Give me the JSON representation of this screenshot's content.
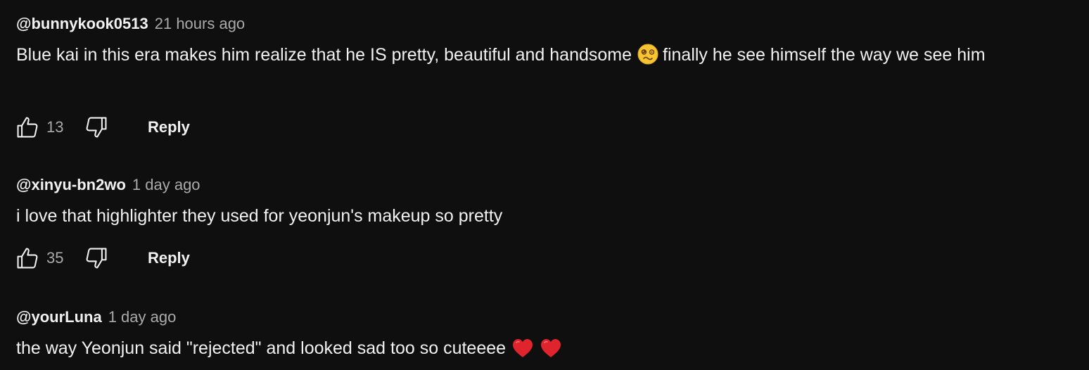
{
  "comments": [
    {
      "author": "@bunnykook0513",
      "time": "21 hours ago",
      "text_before": "Blue kai in this era makes him realize that he IS pretty, beautiful and handsome",
      "emoji_mid": "woozy-face-emoji",
      "text_after": "finally he see himself the way we see him",
      "likes": "13",
      "reply_label": "Reply"
    },
    {
      "author": "@xinyu-bn2wo",
      "time": "1 day ago",
      "text": "i love that highlighter they used for yeonjun's makeup so pretty",
      "likes": "35",
      "reply_label": "Reply"
    },
    {
      "author": "@yourLuna",
      "time": "1 day ago",
      "text": "the way Yeonjun said \"rejected\" and looked sad too so cuteeee",
      "emoji_end": [
        "red-heart-emoji",
        "red-heart-emoji"
      ]
    }
  ],
  "icons": {
    "like": "thumbs-up-icon",
    "dislike": "thumbs-down-icon"
  },
  "colors": {
    "background": "#0f0f0f",
    "primary_text": "#f1f1f1",
    "secondary_text": "#aaaaaa",
    "heart": "#e0242e",
    "woozy_face": "#f7c431"
  }
}
